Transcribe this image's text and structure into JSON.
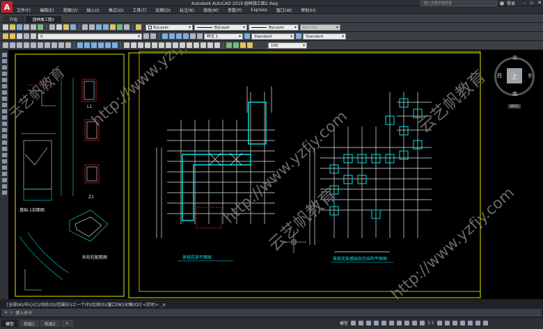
{
  "app": {
    "logo": "A",
    "title": "Autodesk AutoCAD 2019   园林施工图2.dwg",
    "search_placeholder": "键入关键字或短语",
    "login": "登录"
  },
  "menu": [
    "文件(F)",
    "编辑(E)",
    "视图(V)",
    "插入(I)",
    "格式(O)",
    "工具(T)",
    "绘图(D)",
    "标注(N)",
    "修改(M)",
    "参数(P)",
    "Express",
    "窗口(W)",
    "帮助(H)"
  ],
  "doc_tabs": [
    {
      "label": "开始",
      "active": false
    },
    {
      "label": "园林施工图2",
      "active": true
    }
  ],
  "toolbar": {
    "layer_value": "0",
    "color_value": "ByLayer",
    "linetype_value": "ByLayer",
    "lineweight_value": "ByLayer",
    "plotstyle_value": "ByColor",
    "dimstyle_value": "样式 1",
    "textstyle_value": "Standard",
    "tablestyle_value": "Standard",
    "scale_value": "100"
  },
  "drawing": {
    "plan_left_title": "景观花架平面图",
    "plan_right_title": "景观花架基础及柱结构平面图",
    "detail_title": "异形柱配筋图",
    "detail_label1": "基础-1剖面图",
    "section_labels": [
      "L1",
      "Z1"
    ],
    "watermarks": [
      "http://www.yzfjy.com",
      "云艺帆教育"
    ],
    "colors": {
      "background": "#000000",
      "frame": "#e6e600",
      "cyan": "#00e6e6",
      "red": "#ff2a2a",
      "white": "#e8e8e8",
      "green": "#00cc00"
    }
  },
  "viewcube": {
    "north": "北",
    "south": "南",
    "east": "东",
    "west": "西",
    "top_face": "上",
    "wcs": "WCS"
  },
  "command": {
    "history": "[全部(A)/中心(C)/动态(D)/范围(E)/上一个(P)/比例(S)/窗口(W)/对象(O)] <实时>: _e",
    "prompt_placeholder": "键入命令"
  },
  "status": {
    "layouts": [
      {
        "label": "模型",
        "active": true
      },
      {
        "label": "布局1",
        "active": false
      },
      {
        "label": "布局2",
        "active": false
      }
    ],
    "model_label": "模型",
    "scale": "1:1"
  }
}
